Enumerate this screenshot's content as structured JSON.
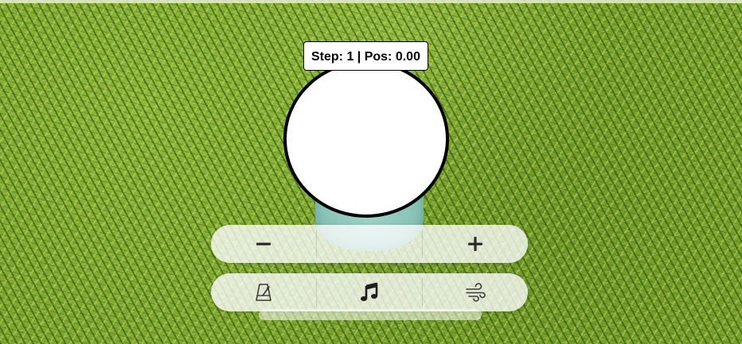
{
  "hud": {
    "step_readout": "Step: 1 | Pos: 0.00"
  },
  "controls": {
    "top_bar": [
      {
        "icon": "minus-icon",
        "name": "decrease-button"
      },
      {
        "icon": "plus-icon",
        "name": "increase-button"
      }
    ],
    "bottom_bar": [
      {
        "icon": "metronome-icon",
        "name": "metronome-button"
      },
      {
        "icon": "music-note-icon",
        "name": "music-button"
      },
      {
        "icon": "wind-icon",
        "name": "wind-button"
      }
    ]
  },
  "colors": {
    "ball_fill": "#ffffff",
    "ball_outline": "#000000",
    "tee": "#8bc4b8",
    "grass": "#7aa52e",
    "icon": "#2b2b2b"
  }
}
